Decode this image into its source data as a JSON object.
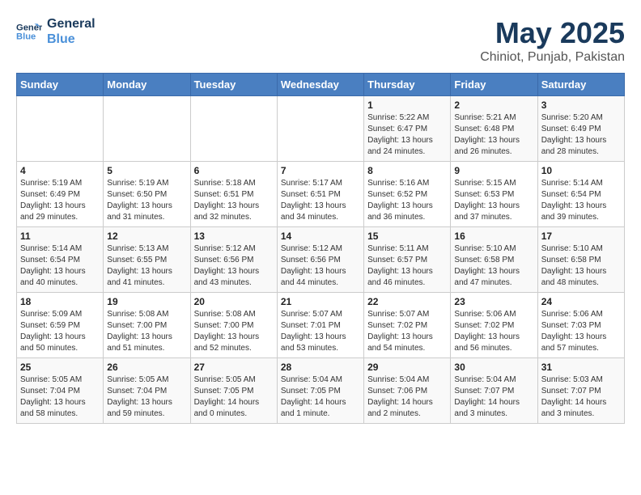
{
  "header": {
    "logo_line1": "General",
    "logo_line2": "Blue",
    "title": "May 2025",
    "subtitle": "Chiniot, Punjab, Pakistan"
  },
  "days_of_week": [
    "Sunday",
    "Monday",
    "Tuesday",
    "Wednesday",
    "Thursday",
    "Friday",
    "Saturday"
  ],
  "weeks": [
    [
      {
        "day": "",
        "info": ""
      },
      {
        "day": "",
        "info": ""
      },
      {
        "day": "",
        "info": ""
      },
      {
        "day": "",
        "info": ""
      },
      {
        "day": "1",
        "info": "Sunrise: 5:22 AM\nSunset: 6:47 PM\nDaylight: 13 hours\nand 24 minutes."
      },
      {
        "day": "2",
        "info": "Sunrise: 5:21 AM\nSunset: 6:48 PM\nDaylight: 13 hours\nand 26 minutes."
      },
      {
        "day": "3",
        "info": "Sunrise: 5:20 AM\nSunset: 6:49 PM\nDaylight: 13 hours\nand 28 minutes."
      }
    ],
    [
      {
        "day": "4",
        "info": "Sunrise: 5:19 AM\nSunset: 6:49 PM\nDaylight: 13 hours\nand 29 minutes."
      },
      {
        "day": "5",
        "info": "Sunrise: 5:19 AM\nSunset: 6:50 PM\nDaylight: 13 hours\nand 31 minutes."
      },
      {
        "day": "6",
        "info": "Sunrise: 5:18 AM\nSunset: 6:51 PM\nDaylight: 13 hours\nand 32 minutes."
      },
      {
        "day": "7",
        "info": "Sunrise: 5:17 AM\nSunset: 6:51 PM\nDaylight: 13 hours\nand 34 minutes."
      },
      {
        "day": "8",
        "info": "Sunrise: 5:16 AM\nSunset: 6:52 PM\nDaylight: 13 hours\nand 36 minutes."
      },
      {
        "day": "9",
        "info": "Sunrise: 5:15 AM\nSunset: 6:53 PM\nDaylight: 13 hours\nand 37 minutes."
      },
      {
        "day": "10",
        "info": "Sunrise: 5:14 AM\nSunset: 6:54 PM\nDaylight: 13 hours\nand 39 minutes."
      }
    ],
    [
      {
        "day": "11",
        "info": "Sunrise: 5:14 AM\nSunset: 6:54 PM\nDaylight: 13 hours\nand 40 minutes."
      },
      {
        "day": "12",
        "info": "Sunrise: 5:13 AM\nSunset: 6:55 PM\nDaylight: 13 hours\nand 41 minutes."
      },
      {
        "day": "13",
        "info": "Sunrise: 5:12 AM\nSunset: 6:56 PM\nDaylight: 13 hours\nand 43 minutes."
      },
      {
        "day": "14",
        "info": "Sunrise: 5:12 AM\nSunset: 6:56 PM\nDaylight: 13 hours\nand 44 minutes."
      },
      {
        "day": "15",
        "info": "Sunrise: 5:11 AM\nSunset: 6:57 PM\nDaylight: 13 hours\nand 46 minutes."
      },
      {
        "day": "16",
        "info": "Sunrise: 5:10 AM\nSunset: 6:58 PM\nDaylight: 13 hours\nand 47 minutes."
      },
      {
        "day": "17",
        "info": "Sunrise: 5:10 AM\nSunset: 6:58 PM\nDaylight: 13 hours\nand 48 minutes."
      }
    ],
    [
      {
        "day": "18",
        "info": "Sunrise: 5:09 AM\nSunset: 6:59 PM\nDaylight: 13 hours\nand 50 minutes."
      },
      {
        "day": "19",
        "info": "Sunrise: 5:08 AM\nSunset: 7:00 PM\nDaylight: 13 hours\nand 51 minutes."
      },
      {
        "day": "20",
        "info": "Sunrise: 5:08 AM\nSunset: 7:00 PM\nDaylight: 13 hours\nand 52 minutes."
      },
      {
        "day": "21",
        "info": "Sunrise: 5:07 AM\nSunset: 7:01 PM\nDaylight: 13 hours\nand 53 minutes."
      },
      {
        "day": "22",
        "info": "Sunrise: 5:07 AM\nSunset: 7:02 PM\nDaylight: 13 hours\nand 54 minutes."
      },
      {
        "day": "23",
        "info": "Sunrise: 5:06 AM\nSunset: 7:02 PM\nDaylight: 13 hours\nand 56 minutes."
      },
      {
        "day": "24",
        "info": "Sunrise: 5:06 AM\nSunset: 7:03 PM\nDaylight: 13 hours\nand 57 minutes."
      }
    ],
    [
      {
        "day": "25",
        "info": "Sunrise: 5:05 AM\nSunset: 7:04 PM\nDaylight: 13 hours\nand 58 minutes."
      },
      {
        "day": "26",
        "info": "Sunrise: 5:05 AM\nSunset: 7:04 PM\nDaylight: 13 hours\nand 59 minutes."
      },
      {
        "day": "27",
        "info": "Sunrise: 5:05 AM\nSunset: 7:05 PM\nDaylight: 14 hours\nand 0 minutes."
      },
      {
        "day": "28",
        "info": "Sunrise: 5:04 AM\nSunset: 7:05 PM\nDaylight: 14 hours\nand 1 minute."
      },
      {
        "day": "29",
        "info": "Sunrise: 5:04 AM\nSunset: 7:06 PM\nDaylight: 14 hours\nand 2 minutes."
      },
      {
        "day": "30",
        "info": "Sunrise: 5:04 AM\nSunset: 7:07 PM\nDaylight: 14 hours\nand 3 minutes."
      },
      {
        "day": "31",
        "info": "Sunrise: 5:03 AM\nSunset: 7:07 PM\nDaylight: 14 hours\nand 3 minutes."
      }
    ]
  ]
}
